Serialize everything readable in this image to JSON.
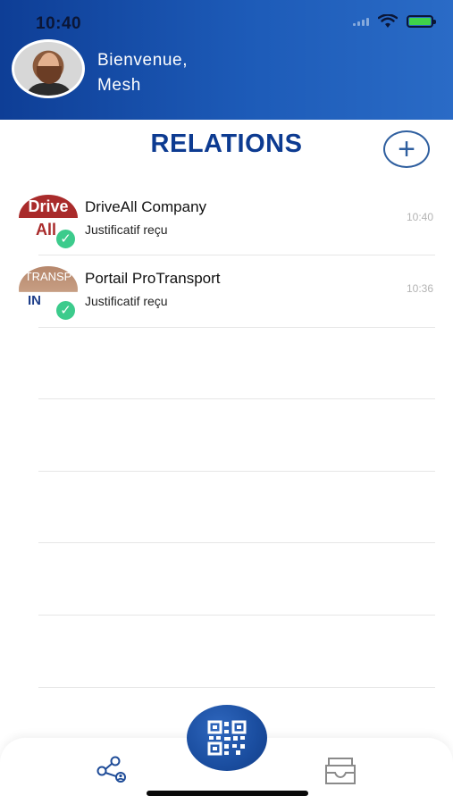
{
  "status_bar": {
    "time": "10:40"
  },
  "header": {
    "greeting_line1": "Bienvenue,",
    "greeting_line2": "Mesh",
    "avatar": "user-avatar"
  },
  "page": {
    "title": "RELATIONS",
    "add_icon": "+"
  },
  "relations": [
    {
      "name": "DriveAll Company",
      "status": "Justificatif reçu",
      "time": "10:40",
      "logo_text_top": "Drive",
      "logo_text_bottom": "All"
    },
    {
      "name": "Portail ProTransport",
      "status": "Justificatif reçu",
      "time": "10:36",
      "logo_text_top": "TRANSP",
      "logo_text_bottom": "IN"
    }
  ],
  "bottom_nav": {
    "share": "share-network-icon",
    "scan": "qr-code-icon",
    "inbox": "inbox-icon"
  },
  "colors": {
    "header_gradient_start": "#0e3e96",
    "header_gradient_end": "#2a6bc6",
    "title": "#0d3b91",
    "check": "#3ccb8c"
  }
}
